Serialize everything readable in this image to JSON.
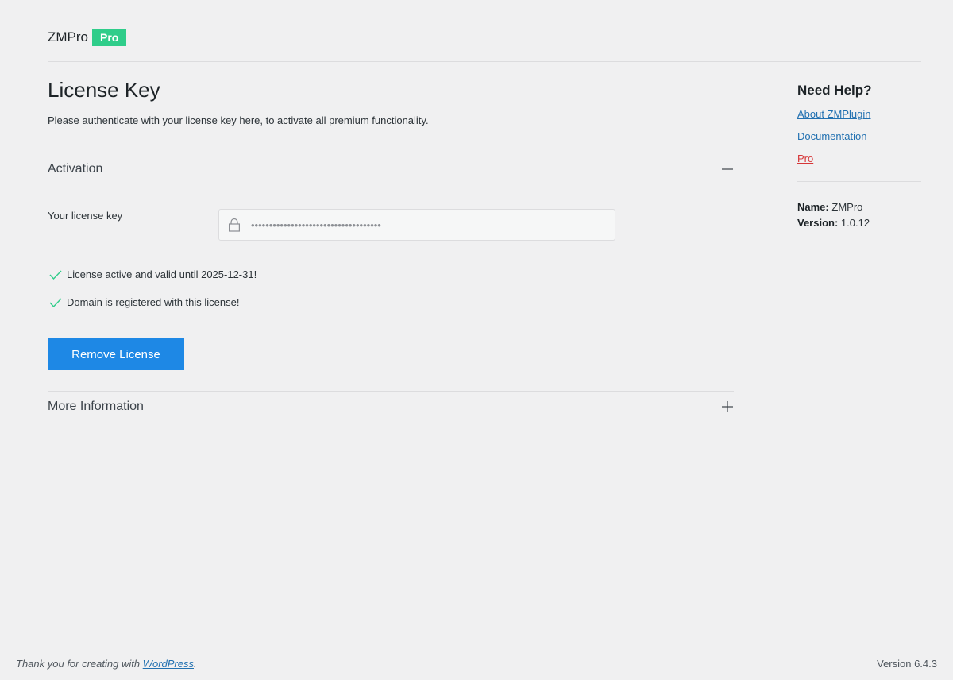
{
  "header": {
    "brand_name": "ZMPro",
    "brand_badge": "Pro"
  },
  "main": {
    "title": "License Key",
    "description": "Please authenticate with your license key here, to activate all premium functionality.",
    "activation": {
      "title": "Activation",
      "toggle_icon": "minus-icon",
      "field_label": "Your license key",
      "field_value": "••••••••••••••••••••••••••••••••••••",
      "lock_icon": "lock-icon",
      "status": [
        {
          "icon": "check-icon",
          "text": "License active and valid until 2025-12-31!"
        },
        {
          "icon": "check-icon",
          "text": "Domain is registered with this license!"
        }
      ],
      "remove_button": "Remove License"
    },
    "more_info": {
      "title": "More Information",
      "toggle_icon": "plus-icon"
    }
  },
  "sidebar": {
    "help_title": "Need Help?",
    "links": [
      "About ZMPlugin",
      "Documentation",
      "Pro"
    ],
    "meta": {
      "name_label": "Name:",
      "name_value": "ZMPro",
      "version_label": "Version:",
      "version_value": "1.0.12"
    }
  },
  "footer": {
    "thanks_prefix": "Thank you for creating with ",
    "thanks_link": "WordPress",
    "thanks_suffix": ".",
    "version": "Version 6.4.3"
  },
  "colors": {
    "accent": "#1e88e5",
    "badge": "#2fcd8a",
    "success": "#2fcd8a",
    "link": "#2271b1",
    "pro_link": "#d63638"
  }
}
